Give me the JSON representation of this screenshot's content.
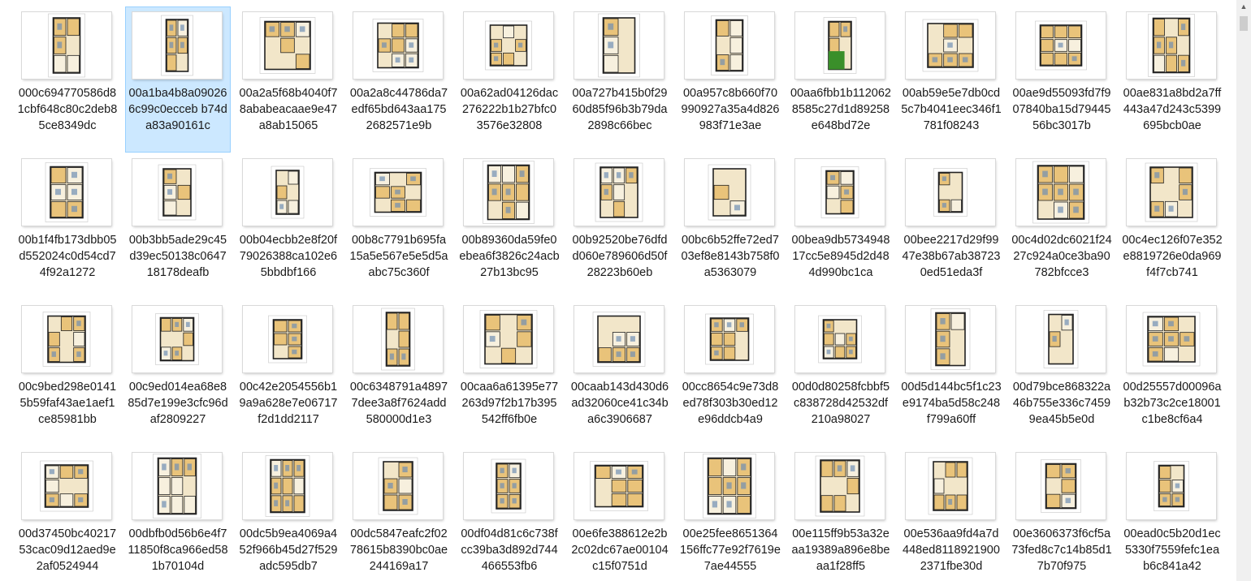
{
  "files": [
    {
      "name": "000c694770586d81cbf648c80c2deb85ce8349dc",
      "variant": 0
    },
    {
      "name": "00a1ba4b8a090266c99c0ecceb b74da83a90161c",
      "variant": 1
    },
    {
      "name": "00a2a5f68b4040f78ababeacaae9e47a8ab15065",
      "variant": 2
    },
    {
      "name": "00a2a8c44786da7edf65bd643aa1752682571e9b",
      "variant": 3
    },
    {
      "name": "00a62ad04126dac276222b1b27bfc03576e32808",
      "variant": 4
    },
    {
      "name": "00a727b415b0f2960d85f96b3b79da2898c66bec",
      "variant": 5
    },
    {
      "name": "00a957c8b660f70990927a35a4d826983f71e3ae",
      "variant": 6
    },
    {
      "name": "00aa6fbb1b1120628585c27d1d89258e648bd72e",
      "variant": 7
    },
    {
      "name": "00ab59e5e7db0cd5c7b4041eec346f1781f08243",
      "variant": 8
    },
    {
      "name": "00ae9d55093fd7f907840ba15d7944556bc3017b",
      "variant": 9
    },
    {
      "name": "00ae831a8bd2a7ff443a47d243c5399695bcb0ae",
      "variant": 10
    },
    {
      "name": "00b1f4fb173dbb05d552024c0d54cd74f92a1272",
      "variant": 11
    },
    {
      "name": "00b3bb5ade29c45d39ec50138c064718178deafb",
      "variant": 12
    },
    {
      "name": "00b04ecbb2e8f20f79026388ca102e65bbdbf166",
      "variant": 13
    },
    {
      "name": "00b8c7791b695fa15a5e567e5e5d5aabc75c360f",
      "variant": 14
    },
    {
      "name": "00b89360da59fe0ebea6f3826c24acb27b13bc95",
      "variant": 15
    },
    {
      "name": "00b92520be76dfdd060e789606d50f28223b60eb",
      "variant": 16
    },
    {
      "name": "00bc6b52ffe72ed703ef8e8143b758f0a5363079",
      "variant": 17
    },
    {
      "name": "00bea9db573494817cc5e8945d2d484d990bc1ca",
      "variant": 18
    },
    {
      "name": "00bee2217d29f9947e38b67ab387230ed51eda3f",
      "variant": 19
    },
    {
      "name": "00c4d02dc6021f2427c924a0ce3ba90782bfcce3",
      "variant": 20
    },
    {
      "name": "00c4ec126f07e352e8819726e0da969f4f7cb741",
      "variant": 21
    },
    {
      "name": "00c9bed298e01415b59faf43ae1aef1ce85981bb",
      "variant": 22
    },
    {
      "name": "00c9ed014ea68e885d7e199e3cfc96daf2809227",
      "variant": 23
    },
    {
      "name": "00c42e2054556b19a9a628e7e06717f2d1dd2117",
      "variant": 24
    },
    {
      "name": "00c6348791a48977dee3a8f7624add580000d1e3",
      "variant": 25
    },
    {
      "name": "00caa6a61395e77263d97f2b17b395542ff6fb0e",
      "variant": 26
    },
    {
      "name": "00caab143d430d6ad32060ce41c34ba6c3906687",
      "variant": 27
    },
    {
      "name": "00cc8654c9e73d8ed78f303b30ed12e96ddcb4a9",
      "variant": 28
    },
    {
      "name": "00d0d80258fcbbf5c838728d42532df210a98027",
      "variant": 29
    },
    {
      "name": "00d5d144bc5f1c23e9174ba5d58c248f799a60ff",
      "variant": 30
    },
    {
      "name": "00d79bce868322a46b755e336c74599ea45b5e0d",
      "variant": 31
    },
    {
      "name": "00d25557d00096ab32b73c2ce18001c1be8cf6a4",
      "variant": 32
    },
    {
      "name": "00d37450bc4021753cac09d12aed9e2af0524944",
      "variant": 33
    },
    {
      "name": "00dbfb0d56b6e4f711850f8ca966ed581b70104d",
      "variant": 34
    },
    {
      "name": "00dc5b9ea4069a452f966b45d27f529adc595db7",
      "variant": 35
    },
    {
      "name": "00dc5847eafc2f0278615b8390bc0ae244169a17",
      "variant": 36
    },
    {
      "name": "00df04d81c6c738fcc39ba3d892d744466553fb6",
      "variant": 37
    },
    {
      "name": "00e6fe388612e2b2c02dc67ae00104c15f0751d",
      "variant": 38
    },
    {
      "name": "00e25fee8651364156ffc77e92f7619e7ae44555",
      "variant": 39
    },
    {
      "name": "00e115ff9b53a32eaa19389a896e8beaa1f28ff5",
      "variant": 40
    },
    {
      "name": "00e536aa9fd4a7d448ed81189219002371fbe30d",
      "variant": 41
    },
    {
      "name": "00e3606373f6cf5a73fed8c7c14b85d17b70f975",
      "variant": 42
    },
    {
      "name": "00ead0c5b20d1ec5330f7559fefc1eab6c841a42",
      "variant": 43
    }
  ],
  "selected_index": 1,
  "colors": {
    "selection_fill": "#cce8ff",
    "selection_border": "#99d1ff",
    "room_fill": "#e9c37a",
    "wall": "#222222",
    "garden": "#3a8f2a"
  },
  "icons": {
    "scroll_up": "scroll-up-arrow-icon"
  }
}
